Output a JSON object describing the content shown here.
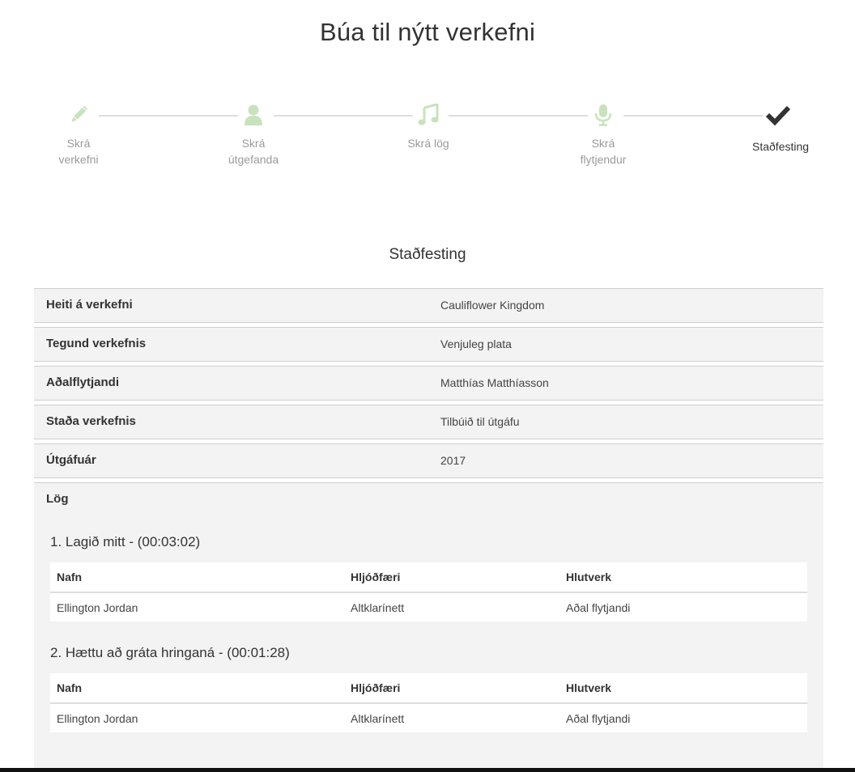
{
  "page": {
    "title": "Búa til nýtt verkefni"
  },
  "stepper": {
    "steps": [
      {
        "label": "Skrá verkefni",
        "icon": "pencil-icon",
        "state": "done"
      },
      {
        "label": "Skrá útgefanda",
        "icon": "user-icon",
        "state": "done"
      },
      {
        "label": "Skrá lög",
        "icon": "music-icon",
        "state": "done"
      },
      {
        "label": "Skrá flytjendur",
        "icon": "microphone-icon",
        "state": "done"
      },
      {
        "label": "Staðfesting",
        "icon": "check-icon",
        "state": "active"
      }
    ],
    "done_color": "#c8e2bd",
    "active_color": "#333333"
  },
  "section": {
    "heading": "Staðfesting"
  },
  "summary": {
    "rows": [
      {
        "label": "Heiti á verkefni",
        "value": "Cauliflower Kingdom"
      },
      {
        "label": "Tegund verkefnis",
        "value": "Venjuleg plata"
      },
      {
        "label": "Aðalflytjandi",
        "value": "Matthías Matthíasson"
      },
      {
        "label": "Staða verkefnis",
        "value": "Tilbúið til útgáfu"
      },
      {
        "label": "Útgáfuár",
        "value": "2017"
      }
    ],
    "songs_label": "Lög"
  },
  "songs": [
    {
      "title": "1. Lagið mitt - (00:03:02)",
      "headers": [
        "Nafn",
        "Hljóðfæri",
        "Hlutverk"
      ],
      "rows": [
        [
          "Ellington Jordan",
          "Altklarínett",
          "Aðal flytjandi"
        ]
      ]
    },
    {
      "title": "2. Hættu að gráta hringaná - (00:01:28)",
      "headers": [
        "Nafn",
        "Hljóðfæri",
        "Hlutverk"
      ],
      "rows": [
        [
          "Ellington Jordan",
          "Altklarínett",
          "Aðal flytjandi"
        ]
      ]
    }
  ]
}
